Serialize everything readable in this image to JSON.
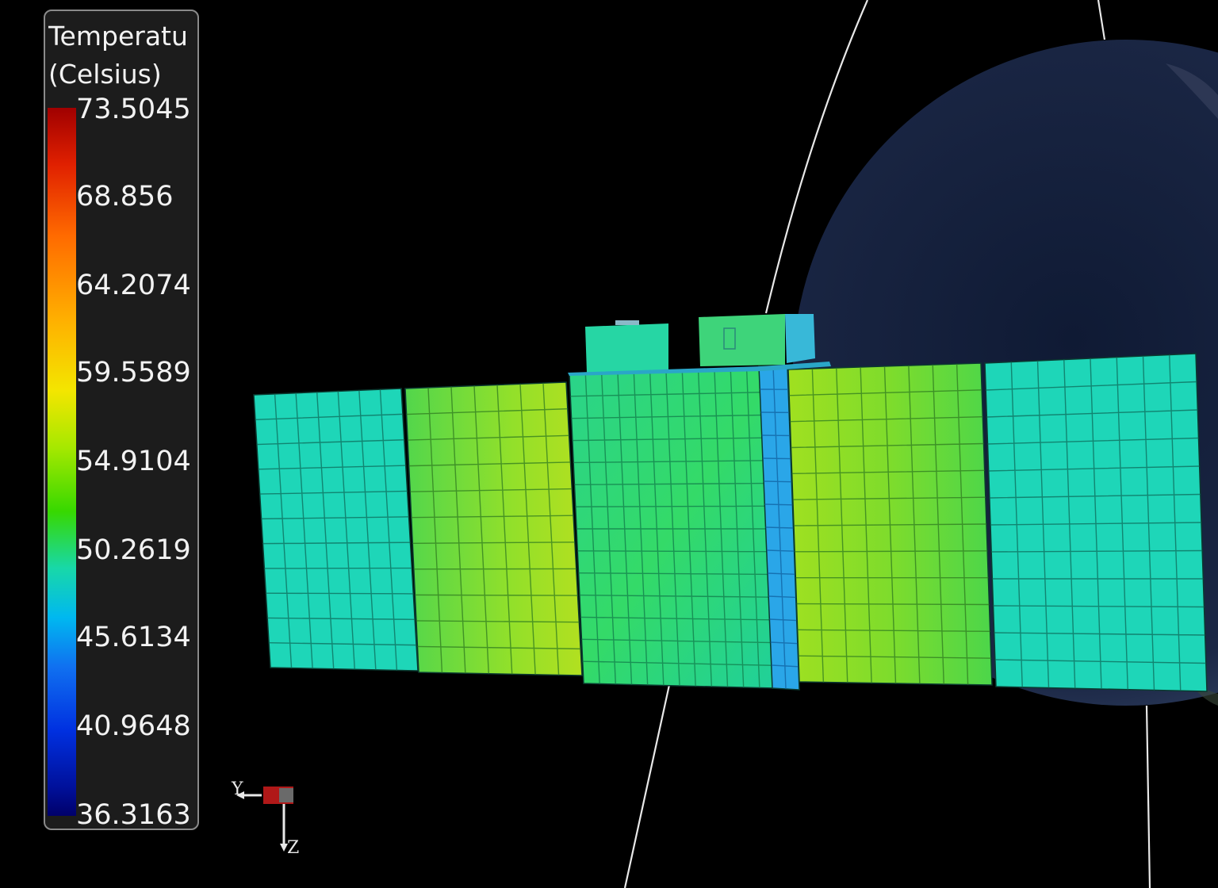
{
  "legend": {
    "title_line1": "Temperatu",
    "title_line2": "(Celsius)",
    "ticks": [
      "73.5045",
      "68.856",
      "64.2074",
      "59.5589",
      "54.9104",
      "50.2619",
      "45.6134",
      "40.9648",
      "36.3163"
    ]
  },
  "axes": {
    "y_label": "Y",
    "z_label": "Z"
  },
  "colors": {
    "background": "#000000",
    "panel_cyan": "#1ed6b8",
    "panel_green": "#62dc3a",
    "panel_lime": "#9ee024",
    "body_green": "#28dc7c",
    "strip_blue": "#2aa6e8",
    "earth": "#1a2540"
  }
}
